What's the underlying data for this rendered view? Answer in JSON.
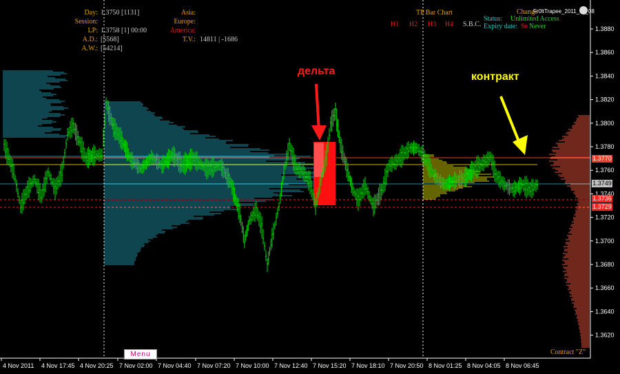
{
  "window": {
    "title": "Fr0ltTrapee_2011_11_08"
  },
  "info_panel": {
    "day_label": "Day:",
    "day_value": "1.3750  [1131]",
    "session_label": "Session:",
    "lp_label": "LP:",
    "lp_value": "1.3758  [1]  00:00",
    "ad_label": "A.D.:",
    "ad_value": "[5568]",
    "aw_label": "A.W.:",
    "aw_value": "[54214]",
    "asia_label": "Asia:",
    "europe_label": "Europe:",
    "america_label": "America:",
    "tv_label": "T.V.:",
    "tv_value": "14811 | -1686"
  },
  "tp_panel": {
    "title": "TP Bar Chart",
    "timeframes": [
      "H1",
      "H2",
      "H3",
      "H4"
    ],
    "sbc": "S.B.C.",
    "change_label": "Change",
    "status_label": "Status:",
    "status_value": "Unlimited Access",
    "expiry_label": "Expiry date:",
    "expiry_value": "Never",
    "se_fragment": "Se"
  },
  "annotations": {
    "delta": "дельта",
    "contract": "контракт"
  },
  "contract_label": "Contract \"Z\"",
  "menu_label": "Menu",
  "price_axis": {
    "labels": [
      "1.3880",
      "1.3860",
      "1.3840",
      "1.3820",
      "1.3800",
      "1.3780",
      "1.3760",
      "1.3740",
      "1.3720",
      "1.3700",
      "1.3680",
      "1.3660",
      "1.3640",
      "1.3620"
    ]
  },
  "price_tags": [
    {
      "value": "1.3770",
      "bg": "#e8402a",
      "fg": "#ffffff"
    },
    {
      "value": "1.3749",
      "bg": "#c0c0c0",
      "fg": "#000000"
    },
    {
      "value": "1.3736",
      "bg": "#ff2020",
      "fg": "#ffffff"
    },
    {
      "value": "1.3729",
      "bg": "#ff2020",
      "fg": "#ffffff"
    }
  ],
  "time_axis": {
    "labels": [
      "4 Nov 2011",
      "4 Nov 17:45",
      "4 Nov 20:25",
      "7 Nov 02:00",
      "7 Nov 04:40",
      "7 Nov 07:20",
      "7 Nov 10:00",
      "7 Nov 12:40",
      "7 Nov 15:20",
      "7 Nov 18:10",
      "7 Nov 20:50",
      "8 Nov 01:25",
      "8 Nov 04:05",
      "8 Nov 06:45"
    ]
  },
  "colors": {
    "bullish": "#00e000",
    "profile": "#1e8a9e",
    "profile_red": "#e0503a",
    "current_profile": "#c8c800",
    "delta_box": "#ff1010",
    "yellow_line": "#e8b000",
    "ann_red": "#ff1a1a",
    "ann_yellow": "#ffff00"
  }
}
